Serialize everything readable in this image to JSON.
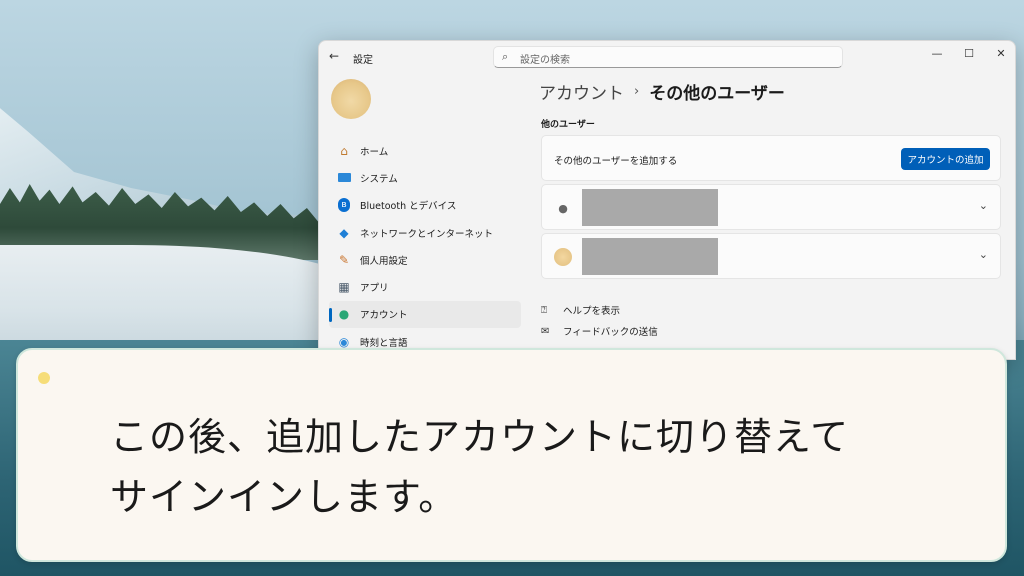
{
  "window": {
    "title": "設定",
    "search_placeholder": "設定の検索",
    "controls": [
      "—",
      "☐",
      "✕"
    ]
  },
  "sidebar": {
    "items": [
      {
        "label": "ホーム",
        "icon": "home-icon",
        "active": false
      },
      {
        "label": "システム",
        "icon": "system-icon",
        "active": false
      },
      {
        "label": "Bluetooth とデバイス",
        "icon": "bluetooth-icon",
        "active": false
      },
      {
        "label": "ネットワークとインターネット",
        "icon": "network-icon",
        "active": false
      },
      {
        "label": "個人用設定",
        "icon": "personalization-icon",
        "active": false
      },
      {
        "label": "アプリ",
        "icon": "apps-icon",
        "active": false
      },
      {
        "label": "アカウント",
        "icon": "accounts-icon",
        "active": true
      },
      {
        "label": "時刻と言語",
        "icon": "time-language-icon",
        "active": false
      }
    ]
  },
  "main": {
    "breadcrumb": {
      "parent": "アカウント",
      "separator": "›",
      "current": "その他のユーザー"
    },
    "section_title": "他のユーザー",
    "add_user": {
      "text": "その他のユーザーを追加する",
      "button_label": "アカウントの追加"
    },
    "links": {
      "help": "ヘルプを表示",
      "feedback": "フィードバックの送信"
    }
  },
  "caption": {
    "line1": "この後、追加したアカウントに切り替えて",
    "line2": "サインインします。"
  },
  "colors": {
    "accent": "#005fb8",
    "caption_bg": "#fbf7f1",
    "caption_dot": "#f6dd78"
  }
}
